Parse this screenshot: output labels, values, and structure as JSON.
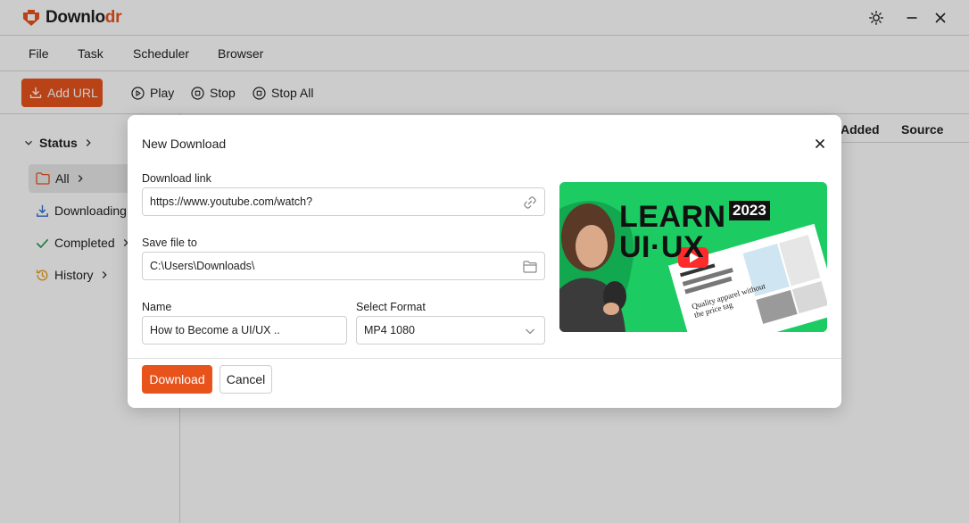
{
  "app": {
    "name_prefix": "Downlo",
    "name_accent": "dr",
    "brand_color": "#e8531c"
  },
  "menu": [
    "File",
    "Task",
    "Scheduler",
    "Browser"
  ],
  "toolbar": {
    "add_url": "Add URL",
    "play": "Play",
    "stop": "Stop",
    "stop_all": "Stop All"
  },
  "sidebar": {
    "section": "Status",
    "items": [
      {
        "label": "All",
        "icon": "folder-icon"
      },
      {
        "label": "Downloading",
        "icon": "download-icon"
      },
      {
        "label": "Completed",
        "icon": "check-icon"
      },
      {
        "label": "History",
        "icon": "history-icon"
      }
    ]
  },
  "table": {
    "columns": [
      "Added",
      "Source"
    ]
  },
  "dialog": {
    "title": "New Download",
    "link_label": "Download link",
    "link_value": "https://www.youtube.com/watch?",
    "save_label": "Save file to",
    "save_value": "C:\\Users\\Downloads\\",
    "name_label": "Name",
    "name_value": "How to Become a UI/UX ..",
    "format_label": "Select Format",
    "format_value": "MP4 1080",
    "download_button": "Download",
    "cancel_button": "Cancel"
  },
  "preview": {
    "line1": "LEARN",
    "line2": "UI·UX",
    "year": "2023",
    "mock_text": "Quality apparel without the price tag"
  }
}
